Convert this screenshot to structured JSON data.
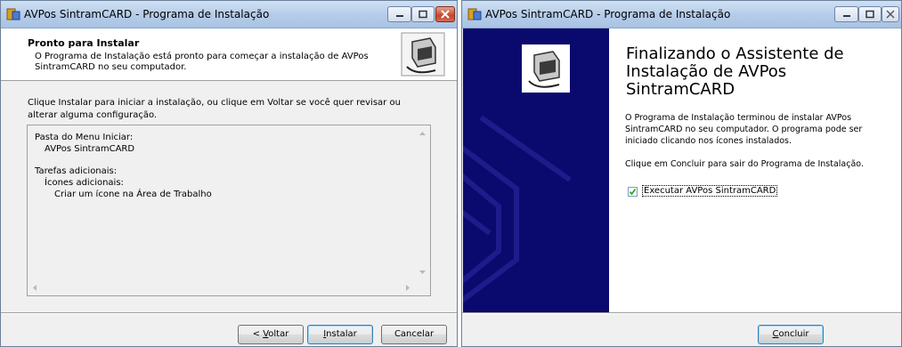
{
  "left_window": {
    "title": "AVPos SintramCARD - Programa de Instalação",
    "header_title": "Pronto para Instalar",
    "header_subtitle": "O Programa de Instalação está pronto para começar a instalação de AVPos SintramCARD no seu computador.",
    "body_text": "Clique Instalar para iniciar a instalação, ou clique em Voltar se você quer revisar ou alterar alguma configuração.",
    "memo_lines": [
      "Pasta do Menu Iniciar:",
      "AVPos SintramCARD",
      "Tarefas adicionais:",
      "Ícones adicionais:",
      "Criar um ícone na Área de Trabalho"
    ],
    "back_button_prefix": "< ",
    "back_button_accel": "V",
    "back_button_rest": "oltar",
    "install_button_accel": "I",
    "install_button_rest": "nstalar",
    "cancel_button": "Cancelar"
  },
  "right_window": {
    "title": "AVPos SintramCARD - Programa de Instalação",
    "finish_title": "Finalizando o Assistente de Instalação de AVPos SintramCARD",
    "finish_text": "O Programa de Instalação terminou de instalar AVPos SintramCARD no seu computador. O programa pode ser iniciado clicando nos ícones instalados.",
    "finish_text2": "Clique em Concluir para sair do Programa de Instalação.",
    "checkbox_label": "Executar AVPos SintramCARD",
    "checkbox_checked": true,
    "finish_button_accel": "C",
    "finish_button_rest": "oncluir"
  },
  "colors": {
    "sidebar": "#0a0a6e",
    "titlebar": "#b6cde9",
    "close_active": "#c7452b"
  }
}
